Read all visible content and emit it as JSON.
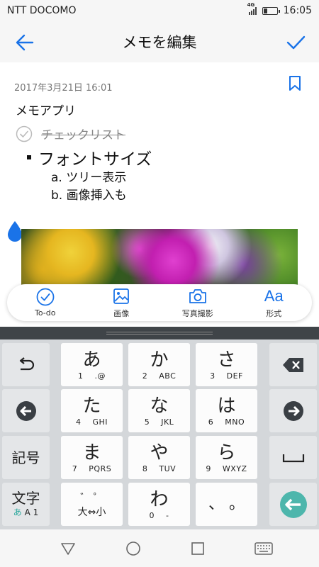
{
  "status": {
    "carrier": "NTT DOCOMO",
    "network": "4G",
    "time": "16:05"
  },
  "header": {
    "title": "メモを編集"
  },
  "memo": {
    "date": "2017年3月21日 16:01",
    "title": "メモアプリ",
    "checklist_item": "チェックリスト",
    "checklist_checked": true,
    "bullet_item": "フォントサイズ",
    "numbered_items": [
      "a. ツリー表示",
      "b. 画像挿入も"
    ]
  },
  "toolbar": {
    "todo": "To-do",
    "image": "画像",
    "camera": "写真撮影",
    "format": "形式",
    "format_glyph": "Aa"
  },
  "keyboard": {
    "keys": [
      {
        "main": "あ",
        "num": "1",
        "sub": ".@"
      },
      {
        "main": "か",
        "num": "2",
        "sub": "ABC"
      },
      {
        "main": "さ",
        "num": "3",
        "sub": "DEF"
      },
      {
        "main": "た",
        "num": "4",
        "sub": "GHI"
      },
      {
        "main": "な",
        "num": "5",
        "sub": "JKL"
      },
      {
        "main": "は",
        "num": "6",
        "sub": "MNO"
      },
      {
        "main": "ま",
        "num": "7",
        "sub": "PQRS"
      },
      {
        "main": "や",
        "num": "8",
        "sub": "TUV"
      },
      {
        "main": "ら",
        "num": "9",
        "sub": "WXYZ"
      }
    ],
    "symbols_label": "記号",
    "mode_main": "文字",
    "mode_sub_kana": "あ",
    "mode_sub_latin": "A 1",
    "dakuten_top": "゛ ゜",
    "dakuten_bottom": "大⇔小",
    "wa_main": "わ",
    "wa_num": "0",
    "wa_sub": "-",
    "punct": "、 。"
  },
  "colors": {
    "accent": "#1a73e8",
    "enter": "#4db6ac",
    "kb_dark": "#3f4448"
  }
}
